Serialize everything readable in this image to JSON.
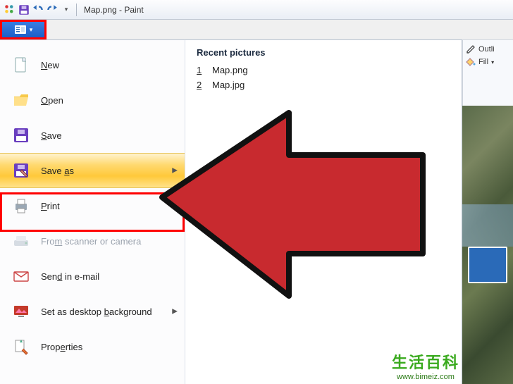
{
  "titlebar": {
    "filename": "Map.png",
    "appname": "Paint",
    "title_full": "Map.png - Paint"
  },
  "ribbon_right": {
    "outline_label": "Outli",
    "fill_label": "Fill"
  },
  "file_menu": {
    "items": [
      {
        "label_html": "<span class='ak'>N</span>ew",
        "icon": "new",
        "arrow": false,
        "disabled": false
      },
      {
        "label_html": "<span class='ak'>O</span>pen",
        "icon": "open",
        "arrow": false,
        "disabled": false
      },
      {
        "label_html": "<span class='ak'>S</span>ave",
        "icon": "save",
        "arrow": false,
        "disabled": false
      },
      {
        "label_html": "Save <span class='ak'>a</span>s",
        "icon": "saveas",
        "arrow": true,
        "disabled": false,
        "hover": true
      },
      {
        "label_html": "<span class='ak'>P</span>rint",
        "icon": "print",
        "arrow": true,
        "disabled": false
      },
      {
        "label_html": "Fro<span class='ak'>m</span> scanner or camera",
        "icon": "scanner",
        "arrow": false,
        "disabled": true
      },
      {
        "label_html": "Sen<span class='ak'>d</span> in e-mail",
        "icon": "email",
        "arrow": false,
        "disabled": false
      },
      {
        "label_html": "Set as desktop <span class='ak'>b</span>ackground",
        "icon": "desktop",
        "arrow": true,
        "disabled": false
      },
      {
        "label_html": "Prop<span class='ak'>e</span>rties",
        "icon": "properties",
        "arrow": false,
        "disabled": false
      }
    ]
  },
  "recent": {
    "heading": "Recent pictures",
    "items": [
      {
        "num": "1",
        "name": "Map.png"
      },
      {
        "num": "2",
        "name": "Map.jpg"
      }
    ]
  },
  "watermark": {
    "text": "生活百科",
    "url": "www.bimeiz.com"
  },
  "colors": {
    "highlight_red": "#ff0000",
    "file_btn_blue": "#1b5fc9",
    "hover_gold": "#ffd96f"
  }
}
